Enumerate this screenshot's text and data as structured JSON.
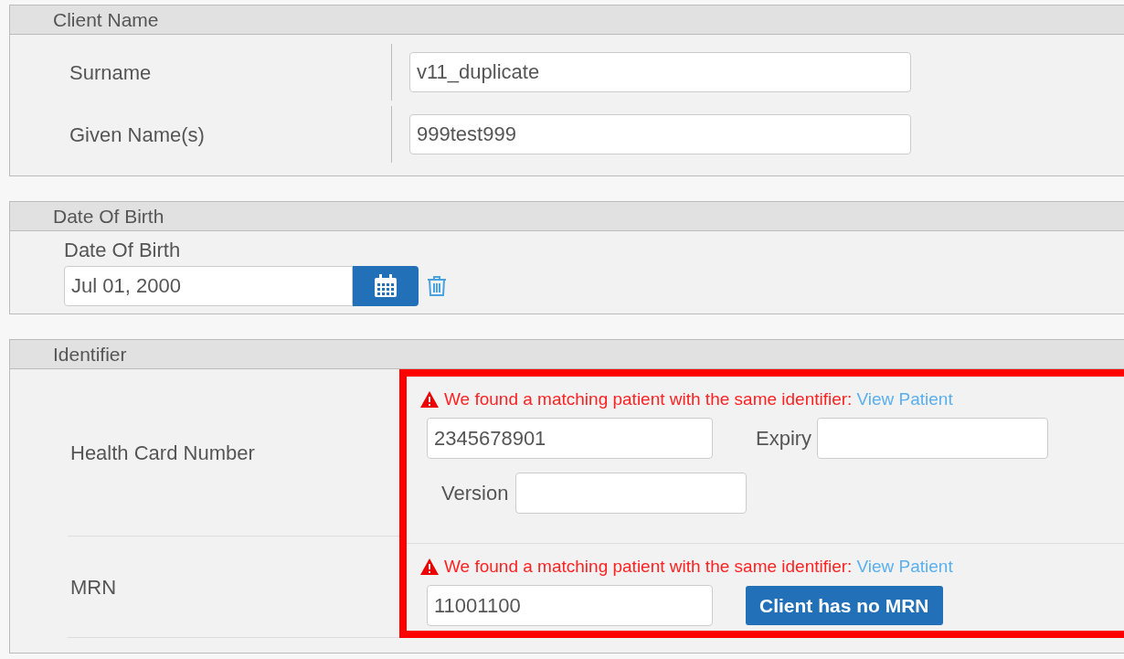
{
  "client_name": {
    "title": "Client Name",
    "fields": [
      {
        "label": "Surname",
        "value": "v11_duplicate"
      },
      {
        "label": "Given Name(s)",
        "value": "999test999"
      }
    ]
  },
  "date_of_birth": {
    "title": "Date Of Birth",
    "label": "Date Of Birth",
    "value": "Jul 01, 2000"
  },
  "identifier": {
    "title": "Identifier",
    "rows": [
      {
        "kind": "health_card",
        "label": "Health Card Number",
        "warning": "We found a matching patient with the same identifier:",
        "link": "View Patient",
        "value": "2345678901",
        "expiry_label": "Expiry",
        "version_label": "Version"
      },
      {
        "kind": "mrn",
        "label": "MRN",
        "warning": "We found a matching patient with the same identifier:",
        "link": "View Patient",
        "value": "11001100",
        "button": "Client has no MRN"
      }
    ]
  }
}
